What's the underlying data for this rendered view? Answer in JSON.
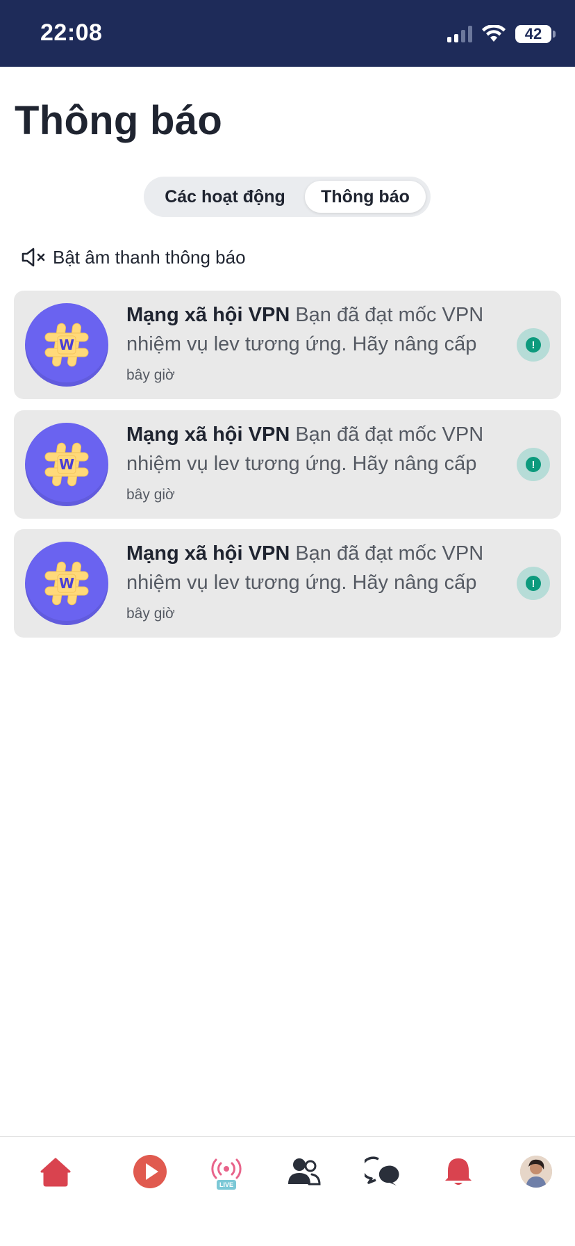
{
  "status_bar": {
    "time": "22:08",
    "battery_level": "42"
  },
  "header": {
    "title": "Thông báo"
  },
  "tabs": [
    {
      "label": "Các hoạt động",
      "selected": false
    },
    {
      "label": "Thông báo",
      "selected": true
    }
  ],
  "sound_toggle": {
    "label": "Bật âm thanh thông báo",
    "icon": "speaker-muted-icon"
  },
  "notifications": [
    {
      "app": "Mạng xã hội VPN",
      "message": "Bạn đã đạt mốc VPN nhiệm vụ lev tương ứng. Hãy nâng cấp",
      "time": "bây giờ"
    },
    {
      "app": "Mạng xã hội VPN",
      "message": "Bạn đã đạt mốc VPN nhiệm vụ lev tương ứng. Hãy nâng cấp",
      "time": "bây giờ"
    },
    {
      "app": "Mạng xã hội VPN",
      "message": "Bạn đã đạt mốc VPN nhiệm vụ lev tương ứng. Hãy nâng cấp",
      "time": "bây giờ"
    }
  ],
  "tabbar": {
    "live_label": "LIVE",
    "items": [
      "home-icon",
      "play-icon",
      "live-icon",
      "friends-icon",
      "chat-icon",
      "bell-icon",
      "profile-avatar"
    ]
  },
  "colors": {
    "status_bar": "#1e2b59",
    "accent_red": "#d9434f",
    "card_bg": "#e9e9e9",
    "avatar_purple": "#6a63f0",
    "alert_green": "#0c9a7d"
  }
}
